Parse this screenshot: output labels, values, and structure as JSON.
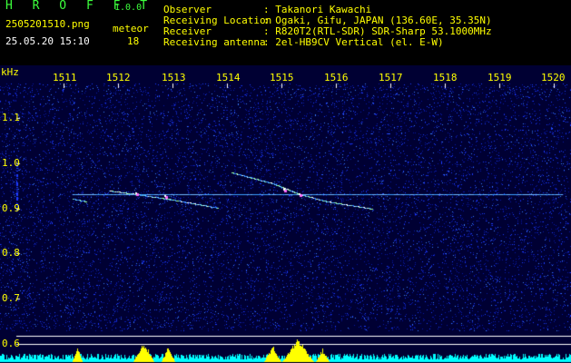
{
  "header": {
    "app_title": "H R O F F T",
    "version": "1.0.0",
    "filename": "2505201510.png",
    "detection_label": "meteor",
    "timestamp": "25.05.20 15:10",
    "detection_count": "18",
    "info": [
      {
        "label": "Observer",
        "value": ": Takanori Kawachi"
      },
      {
        "label": "Receiving Location",
        "value": ": Ogaki, Gifu, JAPAN (136.60E, 35.35N)"
      },
      {
        "label": "Receiver",
        "value": ": R820T2(RTL-SDR) SDR-Sharp 53.1000MHz"
      },
      {
        "label": "Receiving antenna",
        "value": ": 2el-HB9CV Vertical (el. E-W)"
      }
    ]
  },
  "plot": {
    "y_unit": "kHz",
    "x_ticks": [
      "1511",
      "1512",
      "1513",
      "1514",
      "1515",
      "1516",
      "1517",
      "1518",
      "1519",
      "1520"
    ],
    "y_ticks": [
      "1.1",
      "1.0",
      "0.9",
      "0.8",
      "0.7",
      "0.6"
    ],
    "colors": {
      "background": "#000033",
      "noise": "#1e3cff",
      "signal": "#ffffff",
      "histogram": "#ffff00",
      "baseline": "#00ffff",
      "grid": "#ffffff"
    }
  }
}
